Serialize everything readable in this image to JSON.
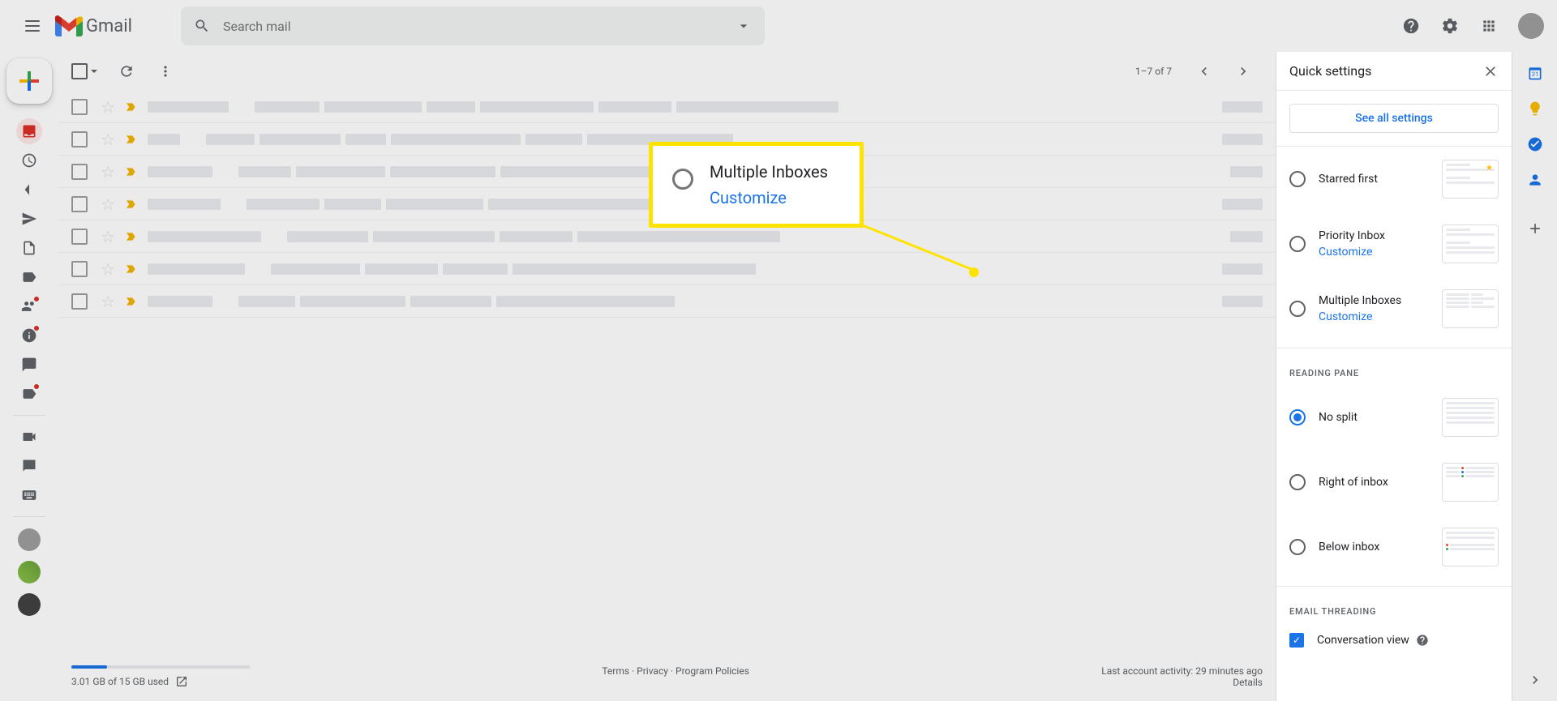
{
  "header": {
    "logo_text": "Gmail",
    "search_placeholder": "Search mail"
  },
  "toolbar": {
    "page_count": "1–7 of 7"
  },
  "footer": {
    "storage_text": "3.01 GB of 15 GB used",
    "terms": "Terms",
    "privacy": "Privacy",
    "policies": "Program Policies",
    "dot1": " · ",
    "dot2": " · ",
    "activity": "Last account activity: 29 minutes ago",
    "details": "Details"
  },
  "settings": {
    "title": "Quick settings",
    "see_all_button": "See all settings",
    "inbox_options": {
      "starred_first": "Starred first",
      "priority_inbox": "Priority Inbox",
      "multiple_inboxes": "Multiple Inboxes",
      "customize": "Customize"
    },
    "reading_pane": {
      "header": "READING PANE",
      "no_split": "No split",
      "right_of_inbox": "Right of inbox",
      "below_inbox": "Below inbox"
    },
    "threading": {
      "header": "EMAIL THREADING",
      "conversation_view": "Conversation view"
    }
  },
  "callout": {
    "title": "Multiple Inboxes",
    "subtitle": "Customize"
  }
}
